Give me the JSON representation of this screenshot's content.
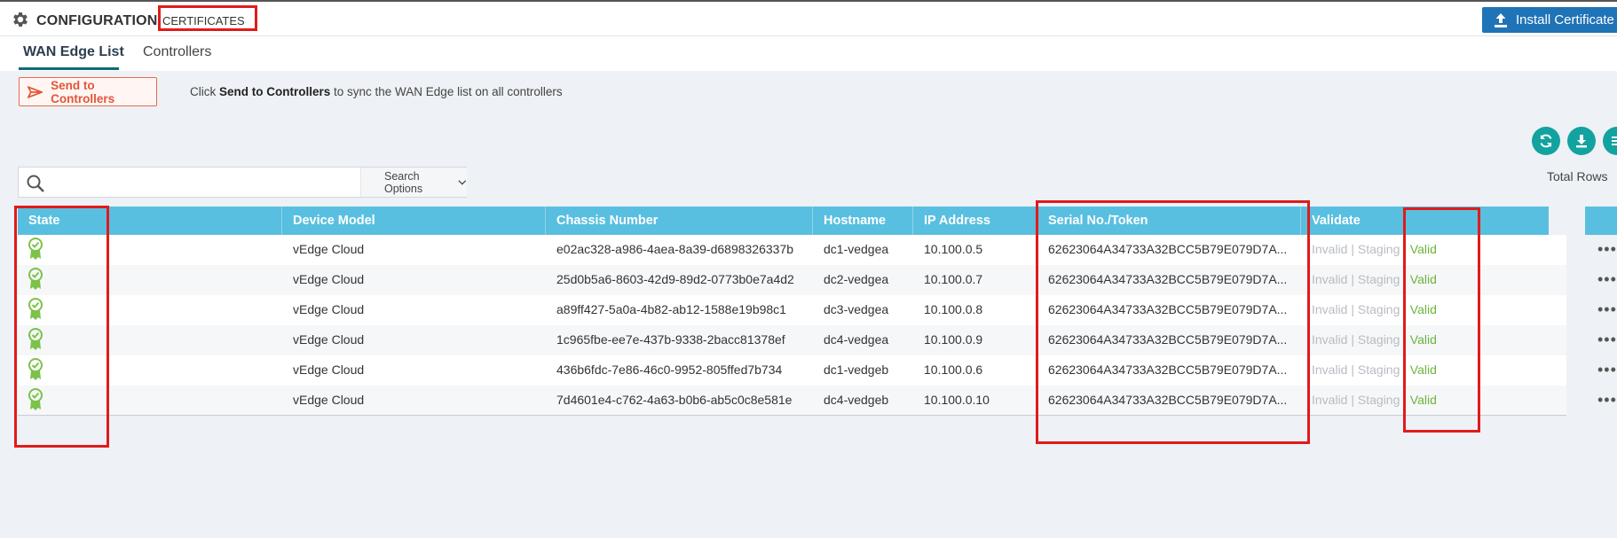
{
  "header": {
    "title": "CONFIGURATION",
    "subtitle": "CERTIFICATES",
    "install_button": "Install Certificate"
  },
  "tabs": [
    {
      "label": "WAN Edge List",
      "active": true
    },
    {
      "label": "Controllers",
      "active": false
    }
  ],
  "toolbar": {
    "send_button": "Send to Controllers",
    "hint_prefix": "Click ",
    "hint_bold": "Send to Controllers",
    "hint_suffix": " to sync the WAN Edge list on all controllers"
  },
  "search": {
    "placeholder": "",
    "options_label": "Search Options"
  },
  "table_tools": {
    "total_rows_label": "Total Rows"
  },
  "table": {
    "columns": [
      "State",
      "Device Model",
      "Chassis Number",
      "Hostname",
      "IP Address",
      "Serial No./Token",
      "Validate"
    ],
    "validate_options": [
      "Invalid",
      "Staging",
      "Valid"
    ],
    "rows": [
      {
        "state": "certificate-valid",
        "model": "vEdge Cloud",
        "chassis": "e02ac328-a986-4aea-8a39-d6898326337b",
        "hostname": "dc1-vedgea",
        "ip": "10.100.0.5",
        "serial": "62623064A34733A32BCC5B79E079D7A...",
        "validate": "Valid"
      },
      {
        "state": "certificate-valid",
        "model": "vEdge Cloud",
        "chassis": "25d0b5a6-8603-42d9-89d2-0773b0e7a4d2",
        "hostname": "dc2-vedgea",
        "ip": "10.100.0.7",
        "serial": "62623064A34733A32BCC5B79E079D7A...",
        "validate": "Valid"
      },
      {
        "state": "certificate-valid",
        "model": "vEdge Cloud",
        "chassis": "a89ff427-5a0a-4b82-ab12-1588e19b98c1",
        "hostname": "dc3-vedgea",
        "ip": "10.100.0.8",
        "serial": "62623064A34733A32BCC5B79E079D7A...",
        "validate": "Valid"
      },
      {
        "state": "certificate-valid",
        "model": "vEdge Cloud",
        "chassis": "1c965fbe-ee7e-437b-9338-2bacc81378ef",
        "hostname": "dc4-vedgea",
        "ip": "10.100.0.9",
        "serial": "62623064A34733A32BCC5B79E079D7A...",
        "validate": "Valid"
      },
      {
        "state": "certificate-valid",
        "model": "vEdge Cloud",
        "chassis": "436b6fdc-7e86-46c0-9952-805ffed7b734",
        "hostname": "dc1-vedgeb",
        "ip": "10.100.0.6",
        "serial": "62623064A34733A32BCC5B79E079D7A...",
        "validate": "Valid"
      },
      {
        "state": "certificate-valid",
        "model": "vEdge Cloud",
        "chassis": "7d4601e4-c762-4a63-b0b6-ab5c0c8e581e",
        "hostname": "dc4-vedgeb",
        "ip": "10.100.0.10",
        "serial": "62623064A34733A32BCC5B79E079D7A...",
        "validate": "Valid"
      }
    ]
  },
  "colors": {
    "accent_teal": "#12a3a0",
    "header_blue": "#59bfe0",
    "install_blue": "#1f73b7",
    "send_orange": "#e2553a",
    "valid_green": "#6cb43c",
    "highlight_red": "#e01b1b"
  }
}
